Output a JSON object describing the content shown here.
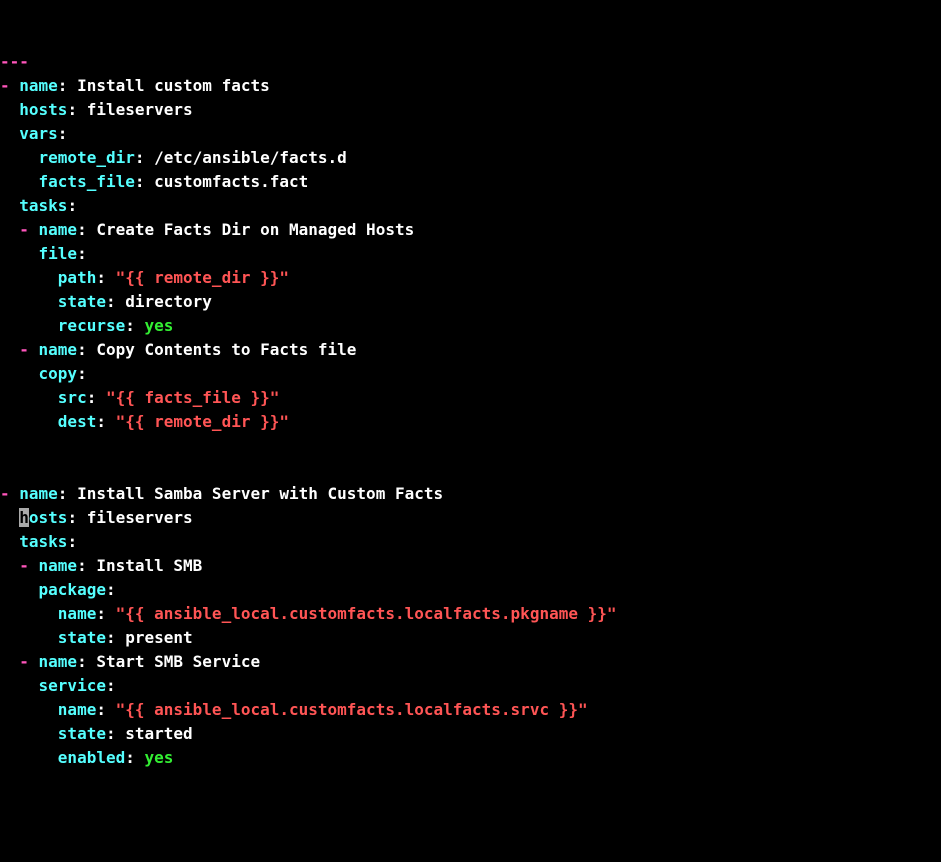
{
  "doc": {
    "top_dashes": "---",
    "play1": {
      "name_key": "name",
      "name_val": " Install custom facts",
      "hosts_key": "hosts",
      "hosts_val": " fileservers",
      "vars_key": "vars",
      "remote_dir_key": "remote_dir",
      "remote_dir_val": " /etc/ansible/facts.d",
      "facts_file_key": "facts_file",
      "facts_file_val": " customfacts.fact",
      "tasks_key": "tasks",
      "task1": {
        "name_key": "name",
        "name_val": " Create Facts Dir on Managed Hosts",
        "mod_key": "file",
        "path_key": "path",
        "path_val": " \"{{ remote_dir }}\"",
        "state_key": "state",
        "state_val": " directory",
        "recurse_key": "recurse",
        "recurse_val": " yes"
      },
      "task2": {
        "name_key": "name",
        "name_val": " Copy Contents to Facts file",
        "mod_key": "copy",
        "src_key": "src",
        "src_val": " \"{{ facts_file }}\"",
        "dest_key": "dest",
        "dest_val": " \"{{ remote_dir }}\""
      }
    },
    "play2": {
      "name_key": "name",
      "name_val": " Install Samba Server with Custom Facts",
      "hosts_key_first": "h",
      "hosts_key_rest": "osts",
      "hosts_val": " fileservers",
      "tasks_key": "tasks",
      "task1": {
        "name_key": "name",
        "name_val": " Install SMB",
        "mod_key": "package",
        "pname_key": "name",
        "pname_val": " \"{{ ansible_local.customfacts.localfacts.pkgname }}\"",
        "state_key": "state",
        "state_val": " present"
      },
      "task2": {
        "name_key": "name",
        "name_val": " Start SMB Service",
        "mod_key": "service",
        "sname_key": "name",
        "sname_val": " \"{{ ansible_local.customfacts.localfacts.srvc }}\"",
        "state_key": "state",
        "state_val": " started",
        "enabled_key": "enabled",
        "enabled_val": " yes"
      }
    }
  }
}
